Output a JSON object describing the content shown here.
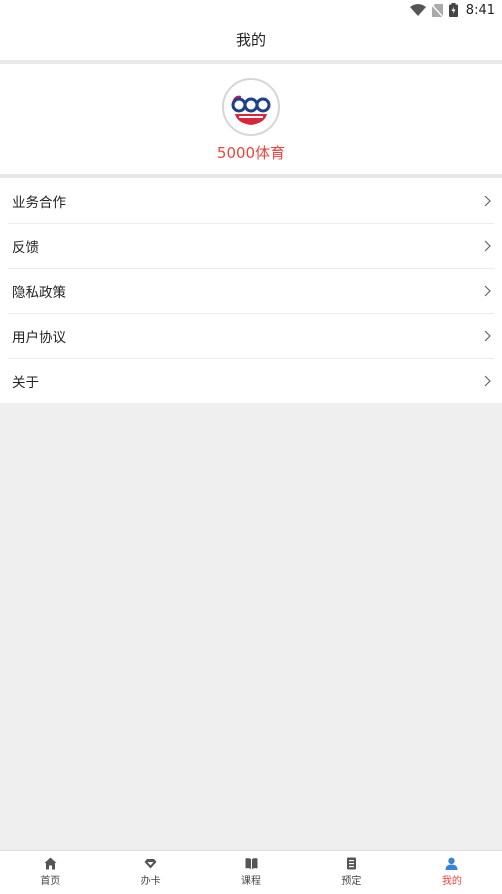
{
  "status_bar": {
    "time": "8:41"
  },
  "header": {
    "title": "我的"
  },
  "profile": {
    "name": "5000体育"
  },
  "menu": {
    "items": [
      {
        "label": "业务合作"
      },
      {
        "label": "反馈"
      },
      {
        "label": "隐私政策"
      },
      {
        "label": "用户协议"
      },
      {
        "label": "关于"
      }
    ]
  },
  "tabbar": {
    "tabs": [
      {
        "label": "首页",
        "icon": "home-icon"
      },
      {
        "label": "办卡",
        "icon": "diamond-icon"
      },
      {
        "label": "课程",
        "icon": "book-icon"
      },
      {
        "label": "预定",
        "icon": "document-icon"
      },
      {
        "label": "我的",
        "icon": "person-icon",
        "active": true
      }
    ]
  },
  "colors": {
    "accent": "#e8463f",
    "active_icon": "#3a83d6",
    "background": "#efefef"
  }
}
